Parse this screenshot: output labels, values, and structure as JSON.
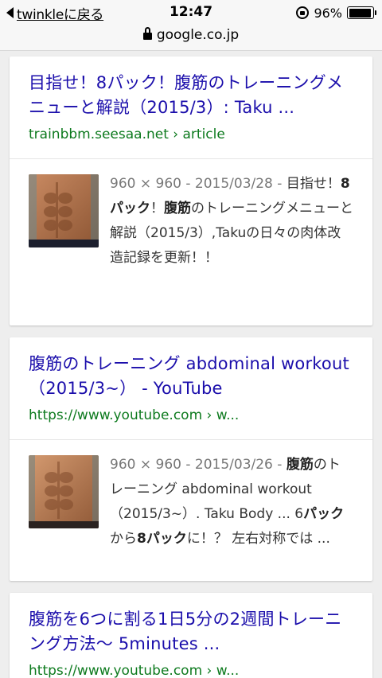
{
  "status_bar": {
    "back_label": "twinkleに戻る",
    "time": "12:47",
    "battery_percent": "96%",
    "battery_level": 0.96
  },
  "url_bar": {
    "domain": "google.co.jp"
  },
  "results": [
    {
      "title": "目指せ！8パック！腹筋のトレーニングメニューと解説（2015/3）: Taku ...",
      "url": "trainbbm.seesaa.net › article",
      "meta": "960 × 960 - 2015/03/28 - ",
      "snippet_parts": [
        "目指せ！",
        "8パック",
        "！",
        "腹筋",
        "のトレーニングメニューと解説（2015/3）,Takuの日々の肉体改造記録を更新！！"
      ]
    },
    {
      "title": "腹筋のトレーニング abdominal workout（2015/3~） - YouTube",
      "url": "https://www.youtube.com › w...",
      "meta": "960 × 960 - 2015/03/26 - ",
      "snippet_parts": [
        "",
        "腹筋",
        "のトレーニング abdominal workout（2015/3~）. Taku Body ... 6",
        "パック",
        "から",
        "8パック",
        "に！？ 左右対称では ..."
      ]
    },
    {
      "title": "腹筋を6つに割る1日5分の2週間トレーニング方法〜 5minutes ...",
      "url": "https://www.youtube.com › w..."
    }
  ]
}
